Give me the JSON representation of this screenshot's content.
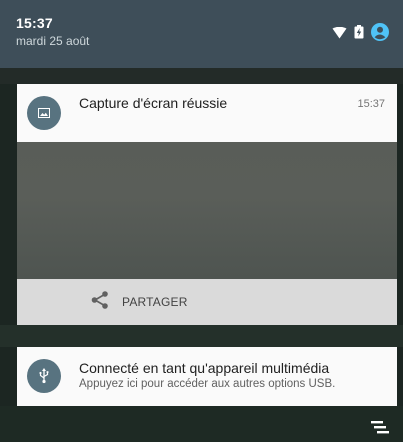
{
  "status": {
    "time": "15:37",
    "date": "mardi 25 août",
    "icons": [
      "wifi-icon",
      "battery-charging-icon",
      "account-icon"
    ]
  },
  "screenshot_notification": {
    "title": "Capture d'écran réussie",
    "time": "15:37",
    "icon": "image-icon",
    "action_label": "PARTAGER",
    "action_icon": "share-icon"
  },
  "usb_notification": {
    "title": "Connecté en tant qu'appareil multimédia",
    "subtitle": "Appuyez ici pour accéder aux autres options USB.",
    "icon": "usb-icon"
  },
  "colors": {
    "status_bar": "#3e4e59",
    "notification_icon_bg": "#587380",
    "card_bg": "#fafafa",
    "action_bar_bg": "#dadada",
    "account_accent": "#4fc3f7"
  }
}
